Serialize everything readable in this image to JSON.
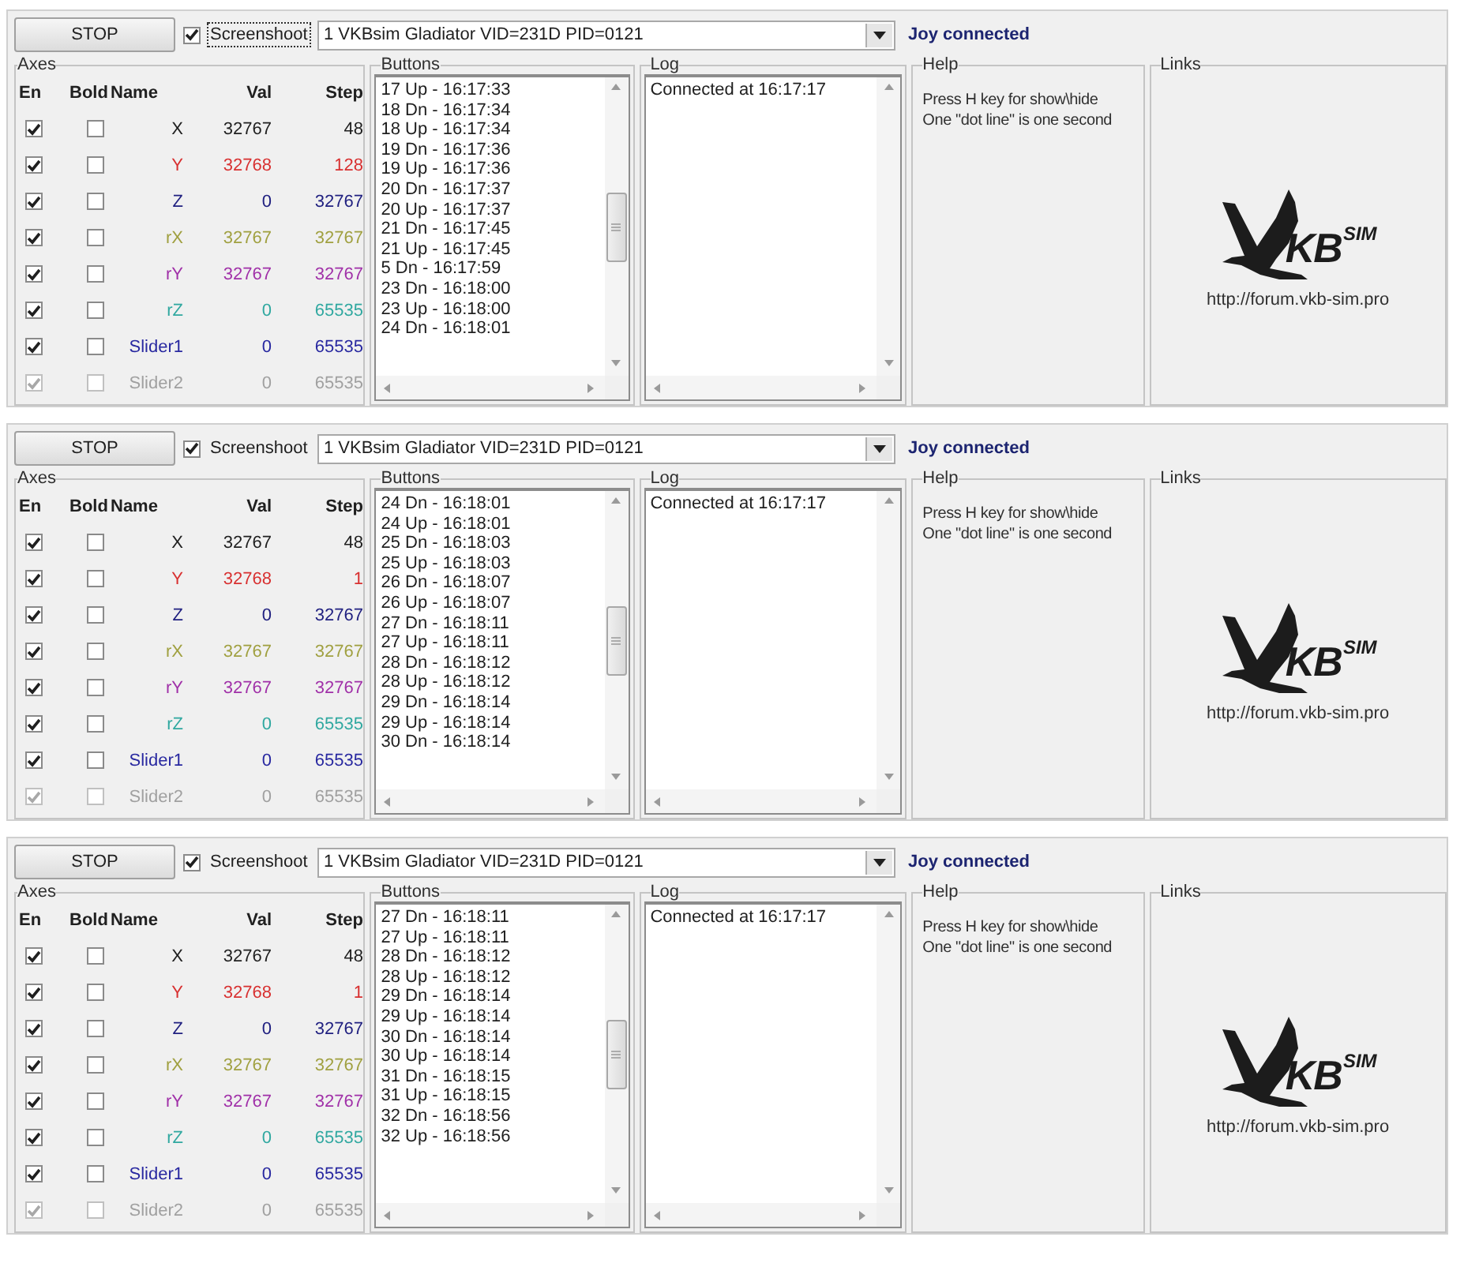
{
  "panels": [
    {
      "stop_button": "STOP",
      "screenshot": {
        "label": "Screenshoot",
        "checked": true,
        "focused": true
      },
      "device": {
        "value": "1 VKBsim Gladiator  VID=231D PID=0121"
      },
      "status": "Joy connected",
      "axes": {
        "title": "Axes",
        "columns": [
          "En",
          "Bold",
          "Name",
          "Val",
          "Step"
        ],
        "rows": [
          {
            "enabled": true,
            "bold": false,
            "disabled": false,
            "name": "X",
            "val": "32767",
            "step": "48",
            "color": "#202020"
          },
          {
            "enabled": true,
            "bold": false,
            "disabled": false,
            "name": "Y",
            "val": "32768",
            "step": "128",
            "color": "#d83030"
          },
          {
            "enabled": true,
            "bold": false,
            "disabled": false,
            "name": "Z",
            "val": "0",
            "step": "32767",
            "color": "#202080"
          },
          {
            "enabled": true,
            "bold": false,
            "disabled": false,
            "name": "rX",
            "val": "32767",
            "step": "32767",
            "color": "#a0a040"
          },
          {
            "enabled": true,
            "bold": false,
            "disabled": false,
            "name": "rY",
            "val": "32767",
            "step": "32767",
            "color": "#a030a8"
          },
          {
            "enabled": true,
            "bold": false,
            "disabled": false,
            "name": "rZ",
            "val": "0",
            "step": "65535",
            "color": "#30a8a0"
          },
          {
            "enabled": true,
            "bold": false,
            "disabled": false,
            "name": "Slider1",
            "val": "0",
            "step": "65535",
            "color": "#2828a0"
          },
          {
            "enabled": true,
            "bold": false,
            "disabled": true,
            "name": "Slider2",
            "val": "0",
            "step": "65535",
            "color": "#a0a0a0"
          }
        ]
      },
      "buttons": {
        "title": "Buttons",
        "lines": [
          "17 Up - 16:17:33",
          "18 Dn - 16:17:34",
          "18 Up - 16:17:34",
          "19 Dn - 16:17:36",
          "19 Up - 16:17:36",
          "20 Dn - 16:17:37",
          "20 Up - 16:17:37",
          "21 Dn - 16:17:45",
          "21 Up - 16:17:45",
          "5 Dn - 16:17:59",
          "23 Dn - 16:18:00",
          "23 Up - 16:18:00",
          "24 Dn - 16:18:01"
        ]
      },
      "log": {
        "title": "Log",
        "lines": [
          "Connected at 16:17:17"
        ]
      },
      "help": {
        "title": "Help",
        "lines": [
          "Press H key for show\\hide",
          "One \"dot line\" is one second"
        ]
      },
      "links": {
        "title": "Links",
        "logo_text": "KB",
        "logo_sup": "SIM",
        "url": "http://forum.vkb-sim.pro"
      }
    },
    {
      "stop_button": "STOP",
      "screenshot": {
        "label": "Screenshoot",
        "checked": true,
        "focused": false
      },
      "device": {
        "value": "1 VKBsim Gladiator  VID=231D PID=0121"
      },
      "status": "Joy connected",
      "axes": {
        "title": "Axes",
        "columns": [
          "En",
          "Bold",
          "Name",
          "Val",
          "Step"
        ],
        "rows": [
          {
            "enabled": true,
            "bold": false,
            "disabled": false,
            "name": "X",
            "val": "32767",
            "step": "48",
            "color": "#202020"
          },
          {
            "enabled": true,
            "bold": false,
            "disabled": false,
            "name": "Y",
            "val": "32768",
            "step": "1",
            "color": "#d83030"
          },
          {
            "enabled": true,
            "bold": false,
            "disabled": false,
            "name": "Z",
            "val": "0",
            "step": "32767",
            "color": "#202080"
          },
          {
            "enabled": true,
            "bold": false,
            "disabled": false,
            "name": "rX",
            "val": "32767",
            "step": "32767",
            "color": "#a0a040"
          },
          {
            "enabled": true,
            "bold": false,
            "disabled": false,
            "name": "rY",
            "val": "32767",
            "step": "32767",
            "color": "#a030a8"
          },
          {
            "enabled": true,
            "bold": false,
            "disabled": false,
            "name": "rZ",
            "val": "0",
            "step": "65535",
            "color": "#30a8a0"
          },
          {
            "enabled": true,
            "bold": false,
            "disabled": false,
            "name": "Slider1",
            "val": "0",
            "step": "65535",
            "color": "#2828a0"
          },
          {
            "enabled": true,
            "bold": false,
            "disabled": true,
            "name": "Slider2",
            "val": "0",
            "step": "65535",
            "color": "#a0a0a0"
          }
        ]
      },
      "buttons": {
        "title": "Buttons",
        "lines": [
          "24 Dn - 16:18:01",
          "24 Up - 16:18:01",
          "25 Dn - 16:18:03",
          "25 Up - 16:18:03",
          "26 Dn - 16:18:07",
          "26 Up - 16:18:07",
          "27 Dn - 16:18:11",
          "27 Up - 16:18:11",
          "28 Dn - 16:18:12",
          "28 Up - 16:18:12",
          "29 Dn - 16:18:14",
          "29 Up - 16:18:14",
          "30 Dn - 16:18:14"
        ]
      },
      "log": {
        "title": "Log",
        "lines": [
          "Connected at 16:17:17"
        ]
      },
      "help": {
        "title": "Help",
        "lines": [
          "Press H key for show\\hide",
          "One \"dot line\" is one second"
        ]
      },
      "links": {
        "title": "Links",
        "logo_text": "KB",
        "logo_sup": "SIM",
        "url": "http://forum.vkb-sim.pro"
      }
    },
    {
      "stop_button": "STOP",
      "screenshot": {
        "label": "Screenshoot",
        "checked": true,
        "focused": false
      },
      "device": {
        "value": "1 VKBsim Gladiator  VID=231D PID=0121"
      },
      "status": "Joy connected",
      "axes": {
        "title": "Axes",
        "columns": [
          "En",
          "Bold",
          "Name",
          "Val",
          "Step"
        ],
        "rows": [
          {
            "enabled": true,
            "bold": false,
            "disabled": false,
            "name": "X",
            "val": "32767",
            "step": "48",
            "color": "#202020"
          },
          {
            "enabled": true,
            "bold": false,
            "disabled": false,
            "name": "Y",
            "val": "32768",
            "step": "1",
            "color": "#d83030"
          },
          {
            "enabled": true,
            "bold": false,
            "disabled": false,
            "name": "Z",
            "val": "0",
            "step": "32767",
            "color": "#202080"
          },
          {
            "enabled": true,
            "bold": false,
            "disabled": false,
            "name": "rX",
            "val": "32767",
            "step": "32767",
            "color": "#a0a040"
          },
          {
            "enabled": true,
            "bold": false,
            "disabled": false,
            "name": "rY",
            "val": "32767",
            "step": "32767",
            "color": "#a030a8"
          },
          {
            "enabled": true,
            "bold": false,
            "disabled": false,
            "name": "rZ",
            "val": "0",
            "step": "65535",
            "color": "#30a8a0"
          },
          {
            "enabled": true,
            "bold": false,
            "disabled": false,
            "name": "Slider1",
            "val": "0",
            "step": "65535",
            "color": "#2828a0"
          },
          {
            "enabled": true,
            "bold": false,
            "disabled": true,
            "name": "Slider2",
            "val": "0",
            "step": "65535",
            "color": "#a0a0a0"
          }
        ]
      },
      "buttons": {
        "title": "Buttons",
        "lines": [
          "27 Dn - 16:18:11",
          "27 Up - 16:18:11",
          "28 Dn - 16:18:12",
          "28 Up - 16:18:12",
          "29 Dn - 16:18:14",
          "29 Up - 16:18:14",
          "30 Dn - 16:18:14",
          "30 Up - 16:18:14",
          "31 Dn - 16:18:15",
          "31 Up - 16:18:15",
          "32 Dn - 16:18:56",
          "32 Up - 16:18:56"
        ]
      },
      "log": {
        "title": "Log",
        "lines": [
          "Connected at 16:17:17"
        ]
      },
      "help": {
        "title": "Help",
        "lines": [
          "Press H key for show\\hide",
          "One \"dot line\" is one second"
        ]
      },
      "links": {
        "title": "Links",
        "logo_text": "KB",
        "logo_sup": "SIM",
        "url": "http://forum.vkb-sim.pro"
      }
    }
  ]
}
